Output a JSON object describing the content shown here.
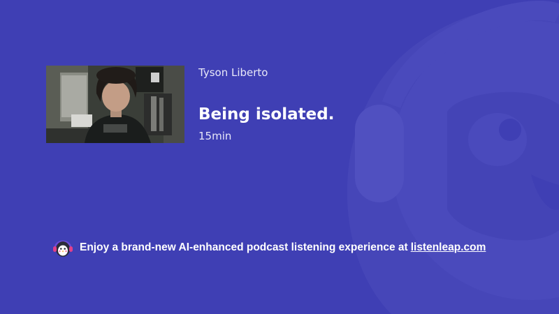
{
  "episode": {
    "author": "Tyson Liberto",
    "title": "Being isolated.",
    "duration": "15min",
    "thumbnail_icon": "podcast-thumbnail-image"
  },
  "promo": {
    "text": "Enjoy a brand-new AI-enhanced podcast listening experience at",
    "link_text": "listenleap.com",
    "logo_icon": "penguin-headphones-icon"
  },
  "colors": {
    "background": "#3f3fb4",
    "mascot_overlay": "#4b4bbc",
    "text": "#ffffff"
  }
}
